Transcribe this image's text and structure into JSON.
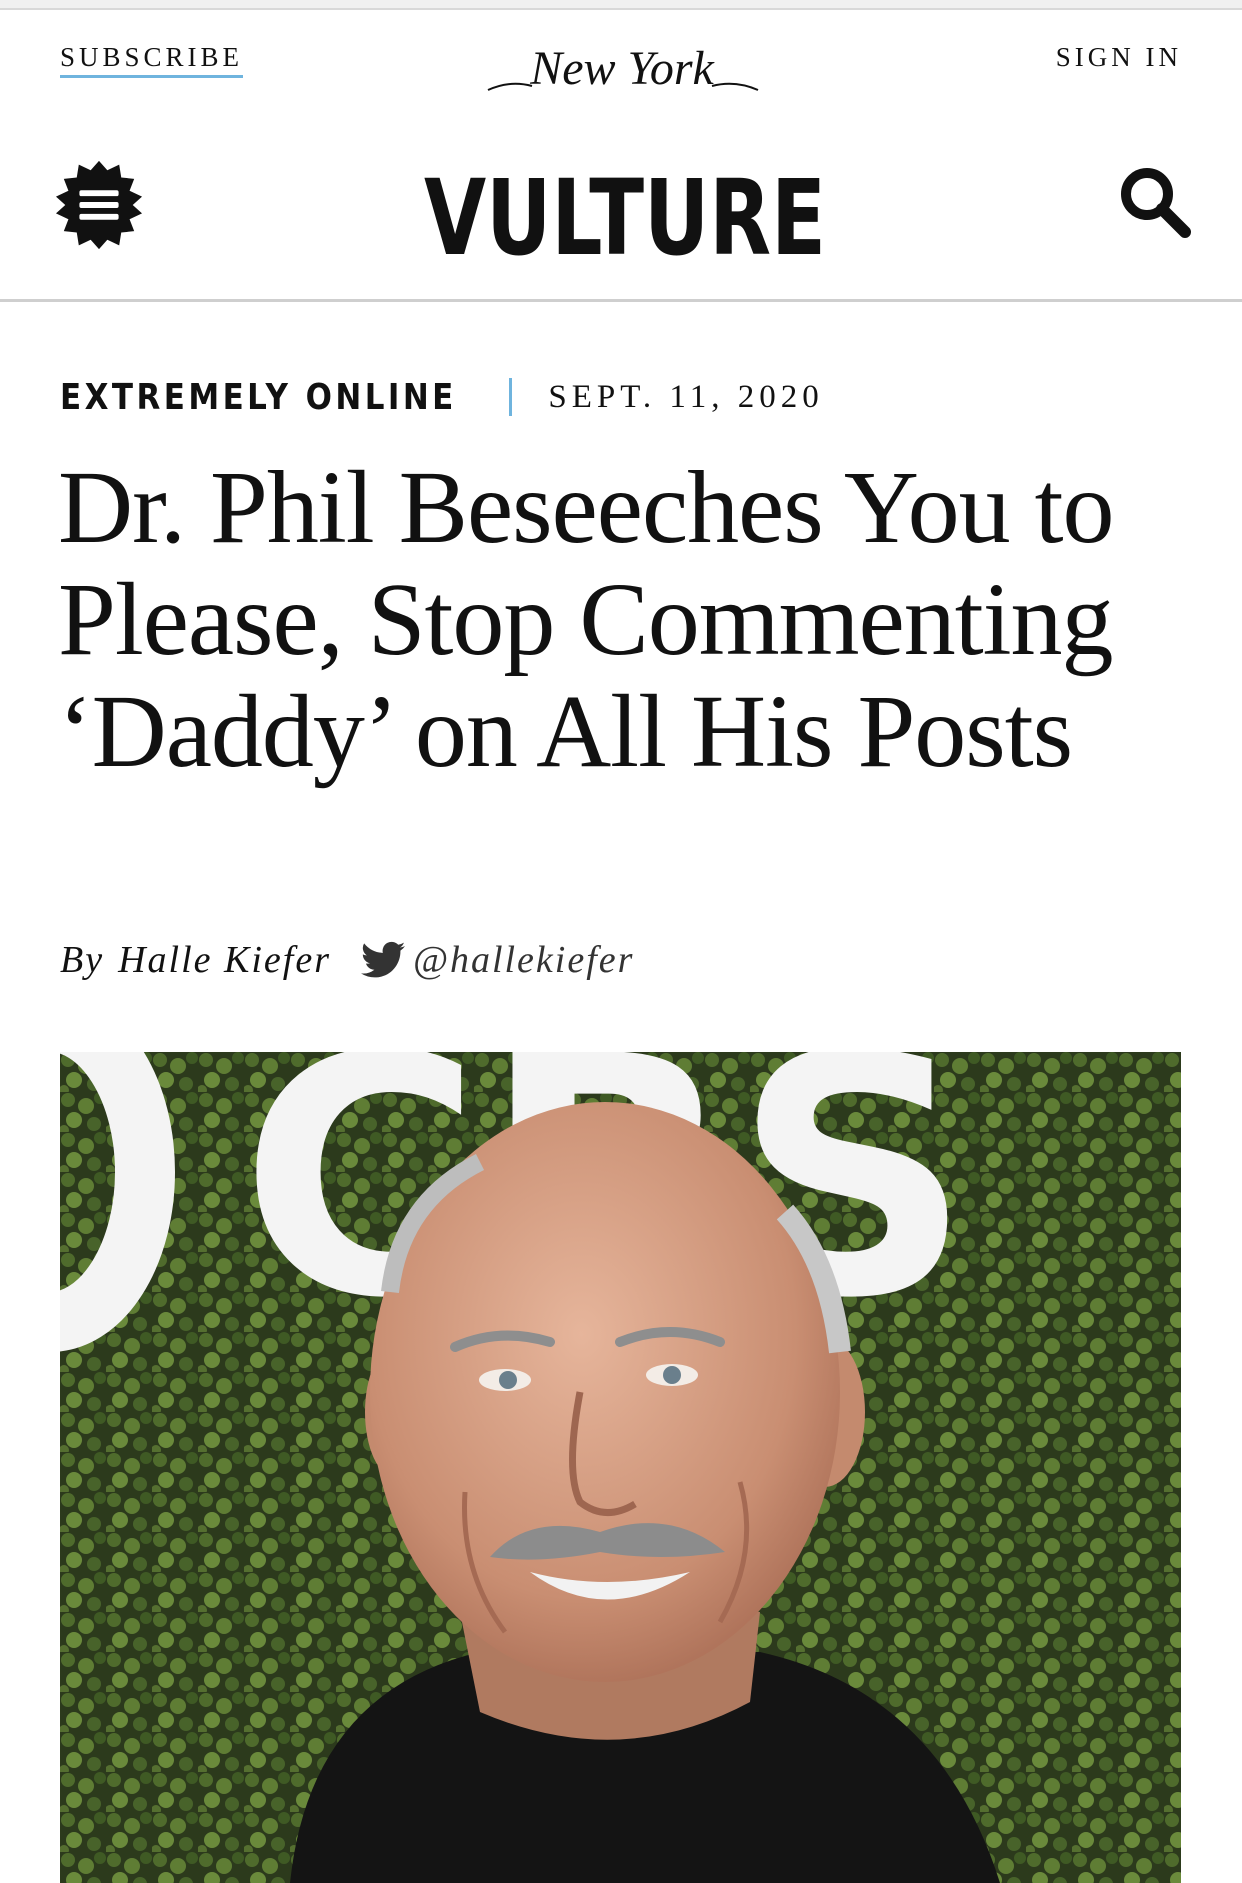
{
  "header": {
    "subscribe_label": "SUBSCRIBE",
    "publication_logo_text": "New York",
    "signin_label": "SIGN IN",
    "site_logo_text": "VULTURE",
    "menu_icon": "hamburger-menu-icon",
    "search_icon": "search-icon"
  },
  "article": {
    "rubric": "EXTREMELY ONLINE",
    "date": "SEPT. 11, 2020",
    "headline": "Dr. Phil Beseeches You to Please, Stop Commenting ‘Daddy’ on All His Posts",
    "byline_prefix": "By",
    "author": "Halle Kiefer",
    "twitter_handle": "@hallekiefer",
    "hero_image_text": "CBS"
  },
  "colors": {
    "accent_blue": "#6fb4de",
    "text": "#111111",
    "divider": "#cfcfcf"
  }
}
